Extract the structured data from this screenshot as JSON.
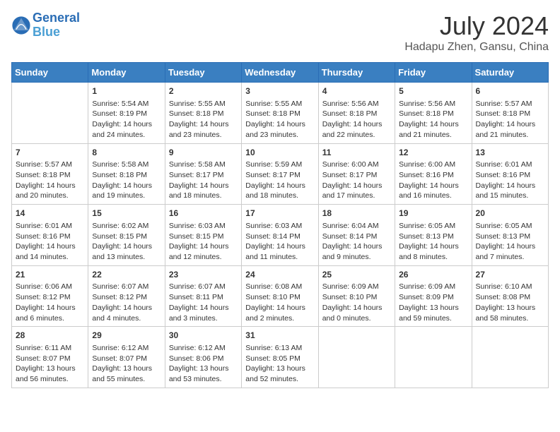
{
  "header": {
    "logo_line1": "General",
    "logo_line2": "Blue",
    "month_year": "July 2024",
    "location": "Hadapu Zhen, Gansu, China"
  },
  "days_of_week": [
    "Sunday",
    "Monday",
    "Tuesday",
    "Wednesday",
    "Thursday",
    "Friday",
    "Saturday"
  ],
  "weeks": [
    [
      {
        "day": "",
        "content": ""
      },
      {
        "day": "1",
        "content": "Sunrise: 5:54 AM\nSunset: 8:19 PM\nDaylight: 14 hours\nand 24 minutes."
      },
      {
        "day": "2",
        "content": "Sunrise: 5:55 AM\nSunset: 8:18 PM\nDaylight: 14 hours\nand 23 minutes."
      },
      {
        "day": "3",
        "content": "Sunrise: 5:55 AM\nSunset: 8:18 PM\nDaylight: 14 hours\nand 23 minutes."
      },
      {
        "day": "4",
        "content": "Sunrise: 5:56 AM\nSunset: 8:18 PM\nDaylight: 14 hours\nand 22 minutes."
      },
      {
        "day": "5",
        "content": "Sunrise: 5:56 AM\nSunset: 8:18 PM\nDaylight: 14 hours\nand 21 minutes."
      },
      {
        "day": "6",
        "content": "Sunrise: 5:57 AM\nSunset: 8:18 PM\nDaylight: 14 hours\nand 21 minutes."
      }
    ],
    [
      {
        "day": "7",
        "content": "Sunrise: 5:57 AM\nSunset: 8:18 PM\nDaylight: 14 hours\nand 20 minutes."
      },
      {
        "day": "8",
        "content": "Sunrise: 5:58 AM\nSunset: 8:18 PM\nDaylight: 14 hours\nand 19 minutes."
      },
      {
        "day": "9",
        "content": "Sunrise: 5:58 AM\nSunset: 8:17 PM\nDaylight: 14 hours\nand 18 minutes."
      },
      {
        "day": "10",
        "content": "Sunrise: 5:59 AM\nSunset: 8:17 PM\nDaylight: 14 hours\nand 18 minutes."
      },
      {
        "day": "11",
        "content": "Sunrise: 6:00 AM\nSunset: 8:17 PM\nDaylight: 14 hours\nand 17 minutes."
      },
      {
        "day": "12",
        "content": "Sunrise: 6:00 AM\nSunset: 8:16 PM\nDaylight: 14 hours\nand 16 minutes."
      },
      {
        "day": "13",
        "content": "Sunrise: 6:01 AM\nSunset: 8:16 PM\nDaylight: 14 hours\nand 15 minutes."
      }
    ],
    [
      {
        "day": "14",
        "content": "Sunrise: 6:01 AM\nSunset: 8:16 PM\nDaylight: 14 hours\nand 14 minutes."
      },
      {
        "day": "15",
        "content": "Sunrise: 6:02 AM\nSunset: 8:15 PM\nDaylight: 14 hours\nand 13 minutes."
      },
      {
        "day": "16",
        "content": "Sunrise: 6:03 AM\nSunset: 8:15 PM\nDaylight: 14 hours\nand 12 minutes."
      },
      {
        "day": "17",
        "content": "Sunrise: 6:03 AM\nSunset: 8:14 PM\nDaylight: 14 hours\nand 11 minutes."
      },
      {
        "day": "18",
        "content": "Sunrise: 6:04 AM\nSunset: 8:14 PM\nDaylight: 14 hours\nand 9 minutes."
      },
      {
        "day": "19",
        "content": "Sunrise: 6:05 AM\nSunset: 8:13 PM\nDaylight: 14 hours\nand 8 minutes."
      },
      {
        "day": "20",
        "content": "Sunrise: 6:05 AM\nSunset: 8:13 PM\nDaylight: 14 hours\nand 7 minutes."
      }
    ],
    [
      {
        "day": "21",
        "content": "Sunrise: 6:06 AM\nSunset: 8:12 PM\nDaylight: 14 hours\nand 6 minutes."
      },
      {
        "day": "22",
        "content": "Sunrise: 6:07 AM\nSunset: 8:12 PM\nDaylight: 14 hours\nand 4 minutes."
      },
      {
        "day": "23",
        "content": "Sunrise: 6:07 AM\nSunset: 8:11 PM\nDaylight: 14 hours\nand 3 minutes."
      },
      {
        "day": "24",
        "content": "Sunrise: 6:08 AM\nSunset: 8:10 PM\nDaylight: 14 hours\nand 2 minutes."
      },
      {
        "day": "25",
        "content": "Sunrise: 6:09 AM\nSunset: 8:10 PM\nDaylight: 14 hours\nand 0 minutes."
      },
      {
        "day": "26",
        "content": "Sunrise: 6:09 AM\nSunset: 8:09 PM\nDaylight: 13 hours\nand 59 minutes."
      },
      {
        "day": "27",
        "content": "Sunrise: 6:10 AM\nSunset: 8:08 PM\nDaylight: 13 hours\nand 58 minutes."
      }
    ],
    [
      {
        "day": "28",
        "content": "Sunrise: 6:11 AM\nSunset: 8:07 PM\nDaylight: 13 hours\nand 56 minutes."
      },
      {
        "day": "29",
        "content": "Sunrise: 6:12 AM\nSunset: 8:07 PM\nDaylight: 13 hours\nand 55 minutes."
      },
      {
        "day": "30",
        "content": "Sunrise: 6:12 AM\nSunset: 8:06 PM\nDaylight: 13 hours\nand 53 minutes."
      },
      {
        "day": "31",
        "content": "Sunrise: 6:13 AM\nSunset: 8:05 PM\nDaylight: 13 hours\nand 52 minutes."
      },
      {
        "day": "",
        "content": ""
      },
      {
        "day": "",
        "content": ""
      },
      {
        "day": "",
        "content": ""
      }
    ]
  ]
}
